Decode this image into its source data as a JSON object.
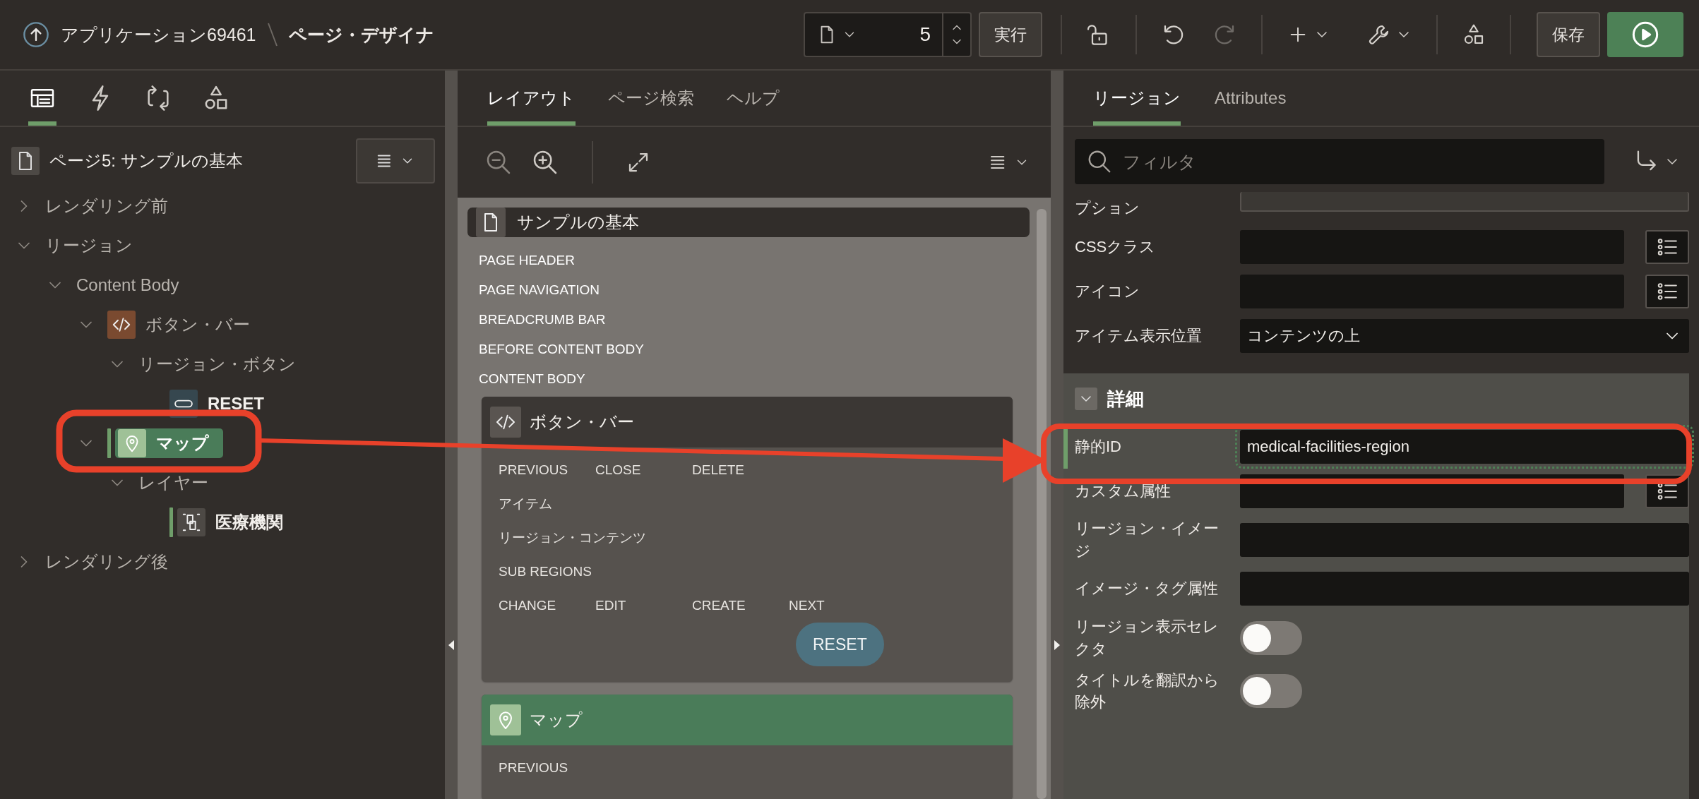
{
  "header": {
    "app_link": "アプリケーション69461",
    "page_title": "ページ・デザイナ"
  },
  "toolbar": {
    "page_number": "5",
    "run_button": "実行",
    "redo_disabled": true,
    "save_button": "保存"
  },
  "left_panel": {
    "tabs": [
      {
        "kind": "rendering",
        "selected": true
      },
      {
        "kind": "dynamic-actions",
        "selected": false
      },
      {
        "kind": "processing",
        "selected": false
      },
      {
        "kind": "shared-components",
        "selected": false
      }
    ],
    "page_title": "ページ5: サンプルの基本",
    "tree": [
      {
        "label": "レンダリング前",
        "expanded": false,
        "selected": false,
        "modified": false
      },
      {
        "label": "リージョン",
        "expanded": true,
        "selected": false,
        "modified": false,
        "children": [
          {
            "label": "Content Body",
            "expanded": true,
            "selected": false,
            "modified": false,
            "children": [
              {
                "label": "ボタン・バー",
                "kind": "code",
                "expanded": true,
                "selected": false,
                "modified": false,
                "children": [
                  {
                    "label": "リージョン・ボタン",
                    "expanded": true,
                    "selected": false,
                    "modified": false,
                    "children": [
                      {
                        "label": "RESET",
                        "kind": "button",
                        "selected": false,
                        "modified": false
                      }
                    ]
                  }
                ]
              },
              {
                "label": "マップ",
                "kind": "map",
                "expanded": true,
                "selected": true,
                "modified": true,
                "children": [
                  {
                    "label": "レイヤー",
                    "expanded": true,
                    "selected": false,
                    "modified": false,
                    "children": [
                      {
                        "label": "医療機関",
                        "kind": "layer",
                        "selected": false,
                        "modified": true
                      }
                    ]
                  }
                ]
              }
            ]
          }
        ]
      },
      {
        "label": "レンダリング後",
        "expanded": false,
        "selected": false,
        "modified": false
      }
    ]
  },
  "middle_panel": {
    "tabs": [
      {
        "label": "レイアウト",
        "selected": true
      },
      {
        "label": "ページ検索",
        "selected": false
      },
      {
        "label": "ヘルプ",
        "selected": false
      }
    ],
    "page_card": {
      "title": "サンプルの基本"
    },
    "positions": [
      "PAGE HEADER",
      "PAGE NAVIGATION",
      "BREADCRUMB BAR",
      "BEFORE CONTENT BODY",
      "CONTENT BODY"
    ],
    "regions": [
      {
        "title": "ボタン・バー",
        "kind": "code",
        "selected": false,
        "slots": [
          {
            "kind": "buttons",
            "labels": [
              "PREVIOUS",
              "CLOSE",
              "DELETE"
            ]
          },
          {
            "kind": "label",
            "text": "アイテム"
          },
          {
            "kind": "label",
            "text": "リージョン・コンテンツ"
          },
          {
            "kind": "label",
            "text": "SUB REGIONS"
          },
          {
            "kind": "buttons",
            "labels": [
              "CHANGE",
              "EDIT",
              "CREATE",
              "NEXT"
            ]
          }
        ],
        "buttons": [
          "RESET"
        ]
      },
      {
        "title": "マップ",
        "kind": "map",
        "selected": true,
        "slots": [
          {
            "kind": "buttons",
            "labels": [
              "PREVIOUS"
            ]
          }
        ]
      }
    ]
  },
  "right_panel": {
    "tabs": [
      {
        "label": "リージョン",
        "selected": true
      },
      {
        "label": "Attributes",
        "selected": false
      }
    ],
    "filter": {
      "placeholder": "フィルタ"
    },
    "properties": [
      {
        "label": "プション",
        "kind": "clipped"
      },
      {
        "label": "CSSクラス",
        "kind": "text-list"
      },
      {
        "label": "アイコン",
        "kind": "text-list"
      },
      {
        "label": "アイテム表示位置",
        "kind": "select",
        "value": "コンテンツの上"
      }
    ],
    "section": {
      "title": "詳細",
      "expanded": true,
      "properties": [
        {
          "label": "静的ID",
          "kind": "text",
          "value": "medical-facilities-region",
          "current": true
        },
        {
          "label": "カスタム属性",
          "kind": "text-list",
          "current": false
        },
        {
          "label": "リージョン・イメージ",
          "kind": "text",
          "current": false
        },
        {
          "label": "イメージ・タグ属性",
          "kind": "text",
          "current": false
        },
        {
          "label": "リージョン表示セレクタ",
          "kind": "switch",
          "on": false,
          "current": false
        },
        {
          "label": "タイトルを翻訳から除外",
          "kind": "switch",
          "on": false,
          "current": false
        }
      ]
    }
  }
}
